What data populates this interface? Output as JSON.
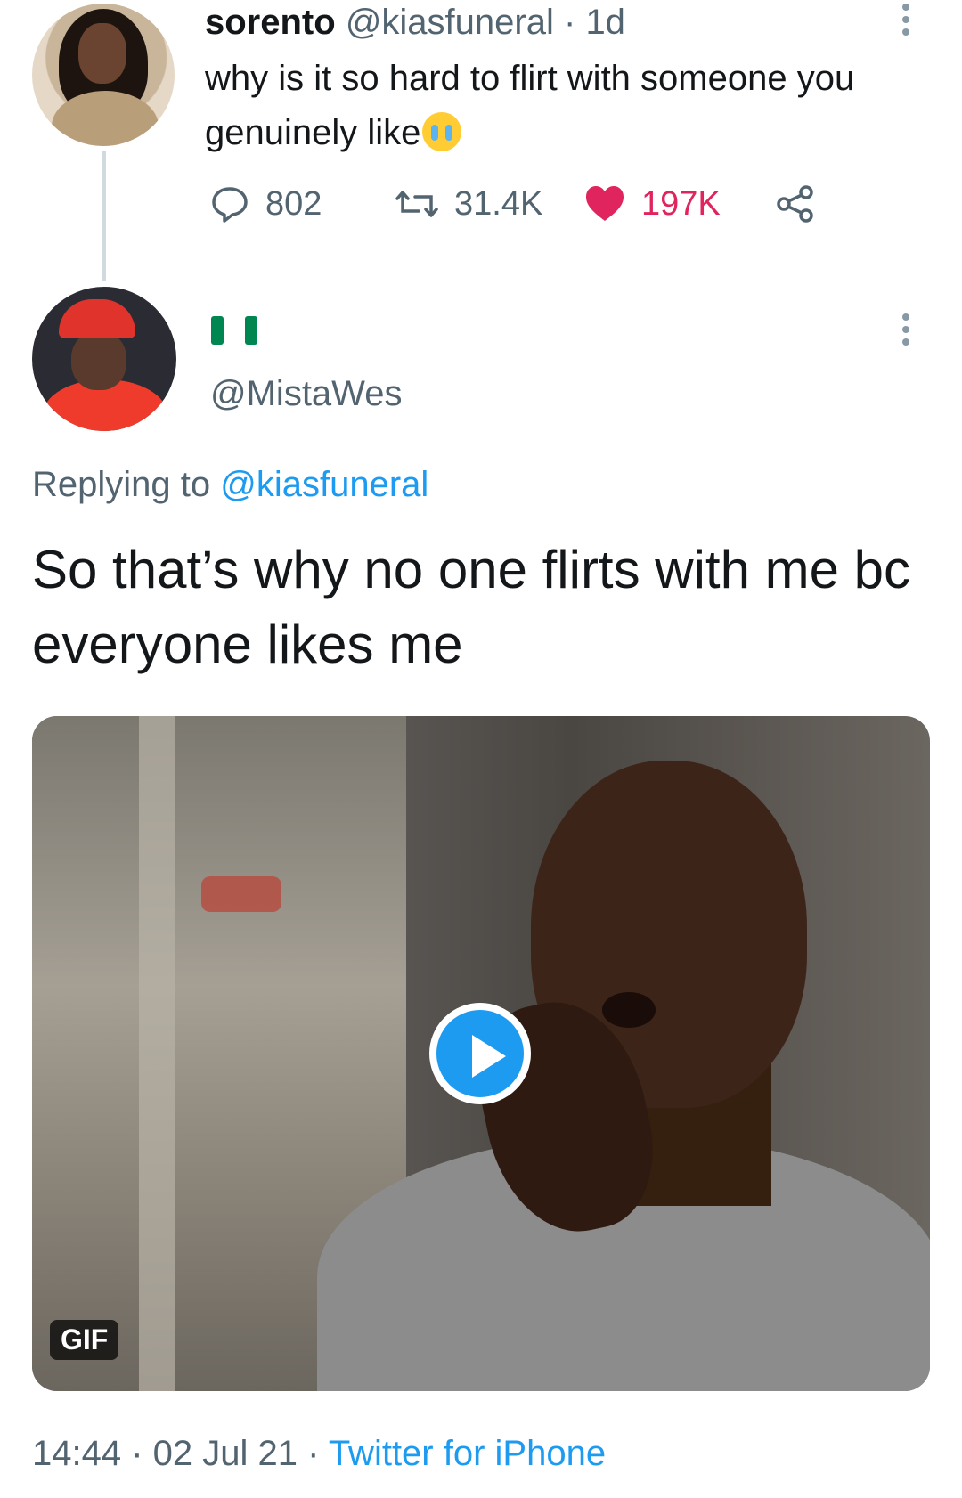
{
  "original_tweet": {
    "display_name": "sorento",
    "handle": "@kiasfuneral",
    "separator": "·",
    "time": "1d",
    "text": "why is it so hard to flirt with someone you genuinely like",
    "emoji": "loudly-crying-face",
    "counts": {
      "replies": "802",
      "retweets": "31.4K",
      "likes": "197K"
    }
  },
  "reply_tweet": {
    "flag": "nigeria-flag",
    "handle": "@MistaWes",
    "replying_prefix": "Replying to ",
    "replying_handle": "@kiasfuneral",
    "text": "So that’s why no one flirts with me bc everyone likes me",
    "media": {
      "badge": "GIF"
    },
    "footer": {
      "time": "14:44",
      "sep1": " · ",
      "date": "02 Jul 21",
      "sep2": " · ",
      "source": "Twitter for iPhone"
    }
  },
  "colors": {
    "accent": "#1d9bf0",
    "like": "#e0245e",
    "muted": "#536471",
    "text": "#14171a"
  }
}
